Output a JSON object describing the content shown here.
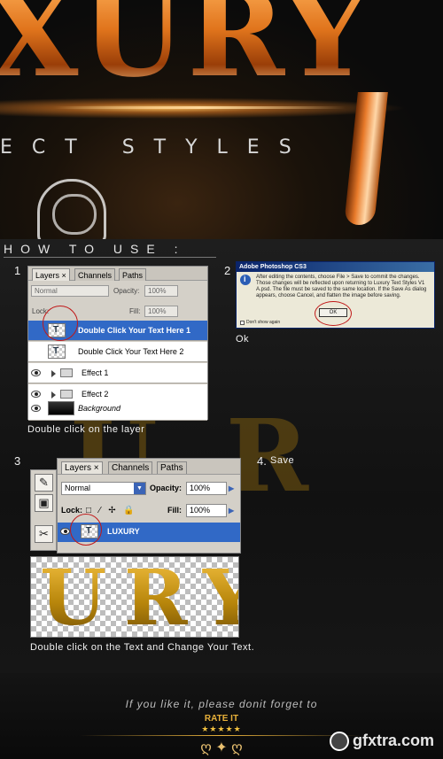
{
  "banner": {
    "title": "XURY",
    "subtitle": "ECT STYLES"
  },
  "how_to_use": "HOW TO USE :",
  "steps": {
    "step1": {
      "number": "1",
      "caption": "Double click on the layer",
      "panel": {
        "tabs": [
          "Layers ×",
          "Channels",
          "Paths"
        ],
        "blend_mode": "Normal",
        "opacity_label": "Opacity:",
        "opacity_value": "100%",
        "lock_label": "Lock:",
        "fill_label": "Fill:",
        "fill_value": "100%",
        "layers": [
          {
            "name": "Double Click Your Text Here 1",
            "selected": true
          },
          {
            "name": "Double Click Your Text Here 2",
            "selected": false
          },
          {
            "name": "Effect 1",
            "selected": false
          },
          {
            "name": "Effect 2",
            "selected": false
          },
          {
            "name": "Background",
            "selected": false
          }
        ]
      }
    },
    "step2": {
      "number": "2",
      "caption": "Ok",
      "dialog": {
        "title": "Adobe Photoshop CS3",
        "message": "After editing the contents, choose File > Save to commit the changes. Those changes will be reflected upon returning to Luxury Text Styles V1 A.psd. The file must be saved to the same location. If the Save As dialog appears, choose Cancel, and flatten the image before saving.",
        "ok_label": "OK",
        "checkbox_label": "Don't show again"
      }
    },
    "step3": {
      "number": "3",
      "caption": "Double click on the Text and Change Your Text.",
      "panel": {
        "tabs": [
          "Layers ×",
          "Channels",
          "Paths"
        ],
        "blend_mode": "Normal",
        "opacity_label": "Opacity:",
        "opacity_value": "100%",
        "lock_label": "Lock:",
        "lock_icons": "□ ⁄ ✢ 🔒",
        "fill_label": "Fill:",
        "fill_value": "100%",
        "layer_name": "LUXURY"
      },
      "preview_text": "URY"
    },
    "step4": {
      "number": "4.",
      "caption": "Save"
    }
  },
  "footer": {
    "line1": "If you like it, please donit forget to",
    "rate": "RATE IT",
    "stars": "★★★★★",
    "swirl": "ღ ✦ ღ",
    "watermark": "gfxtra.com"
  }
}
